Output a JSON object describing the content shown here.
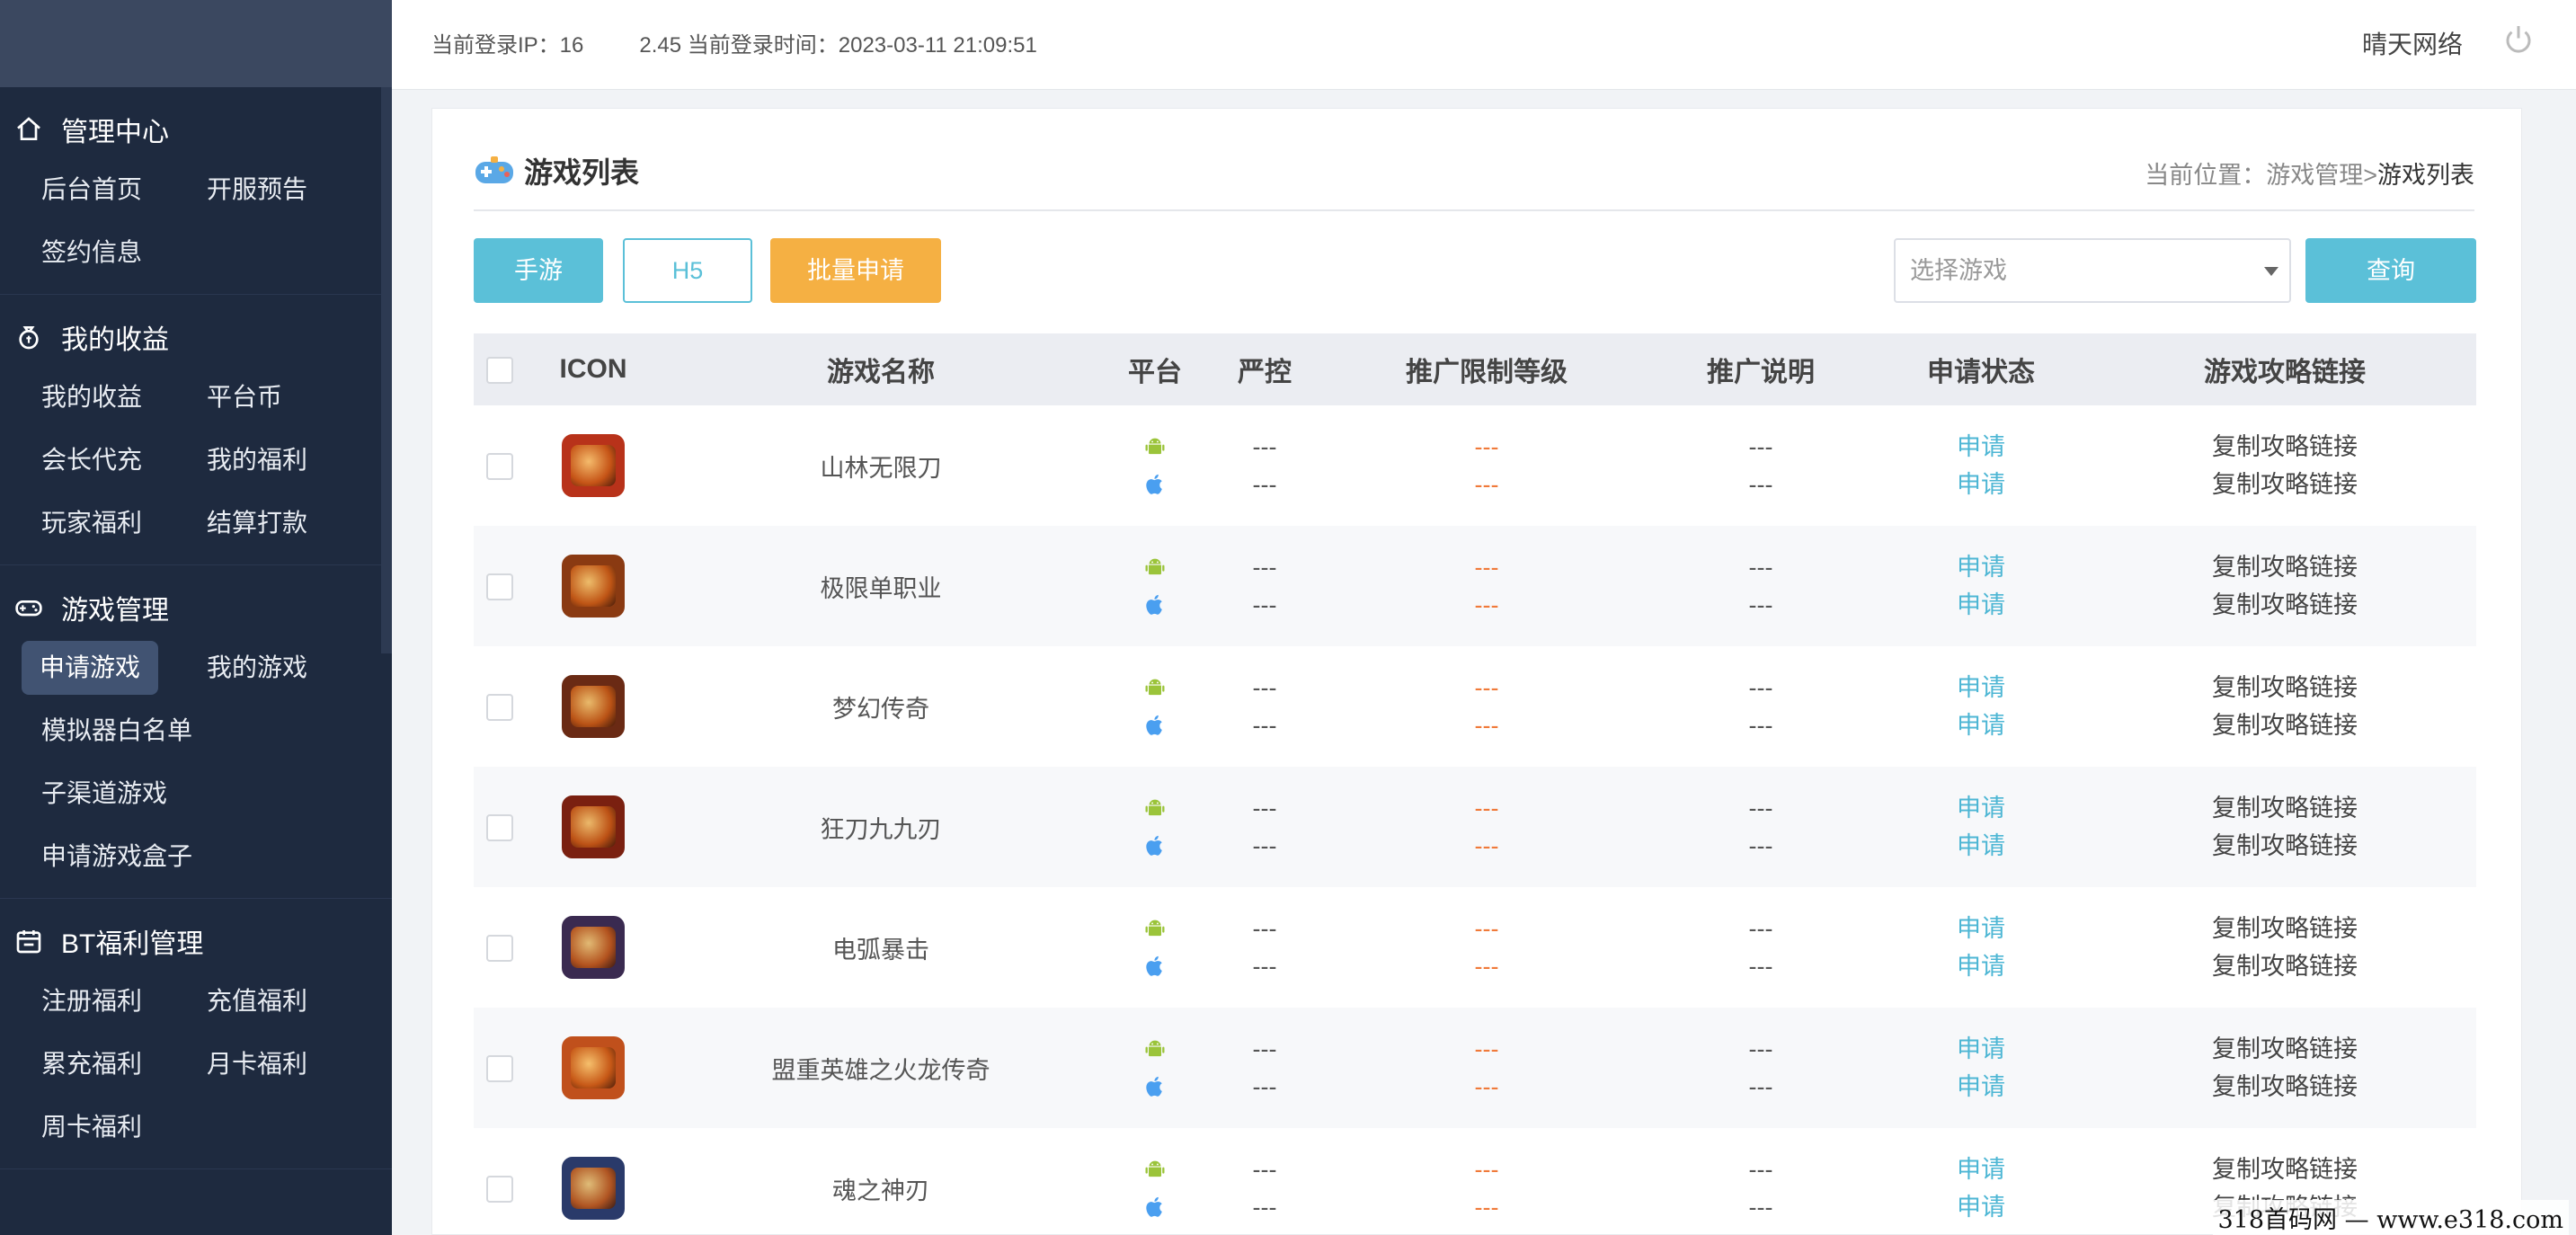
{
  "topbar": {
    "login_ip_label": "当前登录IP：16",
    "login_time_text": "2.45 当前登录时间：2023-03-11 21:09:51",
    "brand": "晴天网络"
  },
  "sidebar": {
    "sections": [
      {
        "title": "管理中心",
        "icon": "home-icon",
        "items": [
          "后台首页",
          "开服预告",
          "签约信息"
        ]
      },
      {
        "title": "我的收益",
        "icon": "money-bag-icon",
        "items": [
          "我的收益",
          "平台币",
          "会长代充",
          "我的福利",
          "玩家福利",
          "结算打款"
        ]
      },
      {
        "title": "游戏管理",
        "icon": "gamepad-icon",
        "items": [
          "申请游戏",
          "我的游戏",
          "模拟器白名单",
          "子渠道游戏",
          "申请游戏盒子"
        ]
      },
      {
        "title": "BT福利管理",
        "icon": "calendar-icon",
        "items": [
          "注册福利",
          "充值福利",
          "累充福利",
          "月卡福利",
          "周卡福利"
        ]
      }
    ],
    "active_item": "申请游戏"
  },
  "page": {
    "title": "游戏列表",
    "breadcrumb_prefix": "当前位置：",
    "breadcrumb_parent": "游戏管理",
    "breadcrumb_sep": ">",
    "breadcrumb_current": "游戏列表"
  },
  "toolbar": {
    "mobile_label": "手游",
    "h5_label": "H5",
    "batch_label": "批量申请",
    "select_placeholder": "选择游戏",
    "query_label": "查询"
  },
  "table": {
    "headers": [
      "ICON",
      "游戏名称",
      "平台",
      "严控",
      "推广限制等级",
      "推广说明",
      "申请状态",
      "游戏攻略链接"
    ],
    "placeholder": "---",
    "status_label": "申请",
    "link_label": "复制攻略链接",
    "rows": [
      {
        "name": "山林无限刀"
      },
      {
        "name": "极限单职业"
      },
      {
        "name": "梦幻传奇"
      },
      {
        "name": "狂刀九九刃"
      },
      {
        "name": "电弧暴击"
      },
      {
        "name": "盟重英雄之火龙传奇"
      },
      {
        "name": "魂之神刃"
      }
    ]
  },
  "watermark": "318首码网 — www.e318.com",
  "colors": {
    "accent": "#5bc0d8",
    "orange": "#f5b043",
    "sidebar": "#1e2a3f"
  }
}
